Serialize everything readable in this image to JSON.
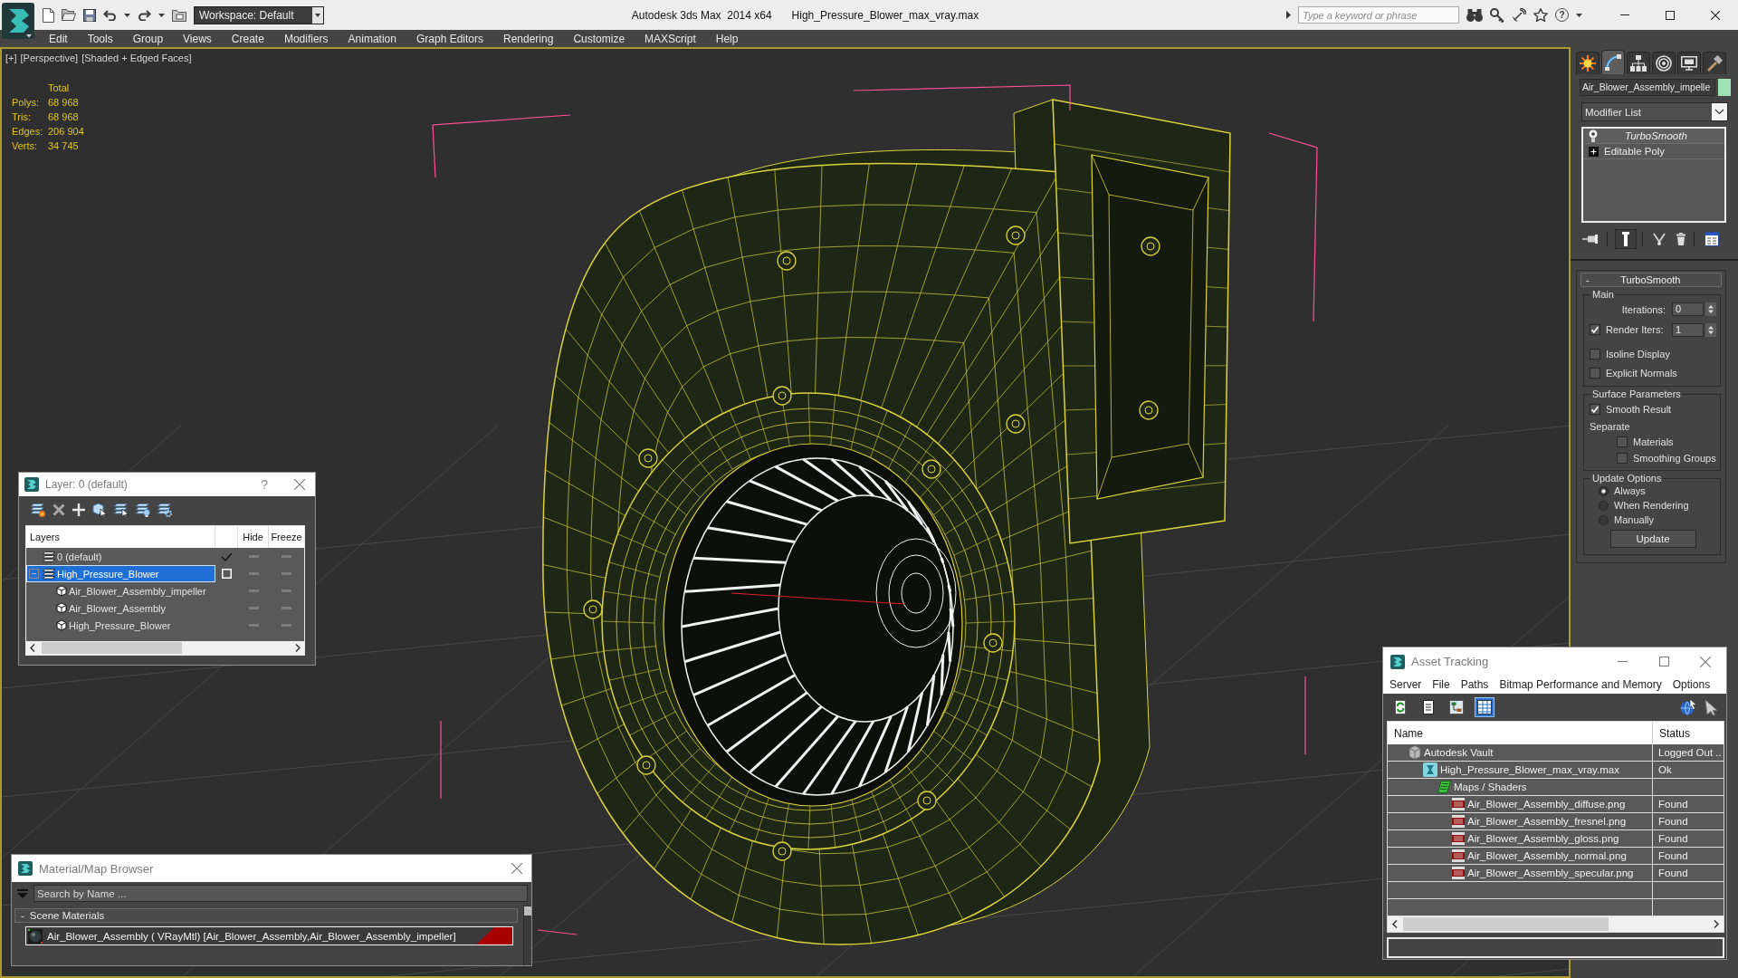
{
  "title_bar": {
    "workspace": "Workspace: Default",
    "app_title": "Autodesk 3ds Max  2014 x64",
    "file_name": "High_Pressure_Blower_max_vray.max",
    "search": {
      "placeholder": "Type a keyword or phrase"
    },
    "help": "?"
  },
  "menu_bar": [
    "Edit",
    "Tools",
    "Group",
    "Views",
    "Create",
    "Modifiers",
    "Animation",
    "Graph Editors",
    "Rendering",
    "Customize",
    "MAXScript",
    "Help"
  ],
  "viewport": {
    "labels": [
      "[+]",
      "[Perspective]",
      "[Shaded + Edged Faces]"
    ],
    "stats": {
      "heading": "Total",
      "rows": [
        {
          "label": "Polys:",
          "value": "68 968"
        },
        {
          "label": "Tris:",
          "value": "68 968"
        },
        {
          "label": "Edges:",
          "value": "206 904"
        },
        {
          "label": "Verts:",
          "value": "34 745"
        }
      ]
    }
  },
  "layer_manager": {
    "title": "Layer: 0 (default)",
    "help": "?",
    "columns": [
      "Layers",
      "Hide",
      "Freeze"
    ],
    "layers": [
      {
        "kind": "layer",
        "name": "0 (default)",
        "current": true,
        "selected": false,
        "hidden": false,
        "frozen": false
      },
      {
        "kind": "layer",
        "name": "High_Pressure_Blower",
        "current": false,
        "selected": true,
        "expanded": true,
        "hidden": false,
        "frozen": false,
        "children": [
          {
            "kind": "object",
            "name": "Air_Blower_Assembly_impeller",
            "selected": false,
            "hidden": false,
            "frozen": false
          },
          {
            "kind": "object",
            "name": "Air_Blower_Assembly",
            "selected": false,
            "hidden": false,
            "frozen": false
          },
          {
            "kind": "object",
            "name": "High_Pressure_Blower",
            "selected": false,
            "hidden": false,
            "frozen": false
          }
        ]
      }
    ]
  },
  "command_panel": {
    "tabs": [
      {
        "kind": "create",
        "selected": false
      },
      {
        "kind": "modify",
        "selected": true
      },
      {
        "kind": "hierarchy",
        "selected": false
      },
      {
        "kind": "motion",
        "selected": false
      },
      {
        "kind": "display",
        "selected": false
      },
      {
        "kind": "utilities",
        "selected": false
      }
    ],
    "object": {
      "name": "Air_Blower_Assembly_impelle",
      "color": "#9fe3b5"
    },
    "modifier_list": "Modifier List",
    "stack": [
      {
        "kind": "modifier",
        "name": "TurboSmooth"
      },
      {
        "kind": "base_object",
        "name": "Editable Poly"
      }
    ],
    "stack_tools": [
      {
        "kind": "pin",
        "on": false
      },
      {
        "kind": "end_result",
        "on": true
      },
      {
        "kind": "make_unique",
        "on": false
      },
      {
        "kind": "remove",
        "on": false
      },
      {
        "kind": "configure",
        "on": false
      }
    ],
    "rollout": {
      "toggle": "-",
      "title": "TurboSmooth",
      "groups": [
        {
          "title": "Main",
          "items": [
            {
              "kind": "spinner",
              "label": "Iterations:",
              "value": "0"
            },
            {
              "kind": "check_spinner",
              "label": "Render Iters:",
              "checked": true,
              "value": "1"
            },
            {
              "kind": "checkbox",
              "label": "Isoline Display",
              "checked": false
            },
            {
              "kind": "checkbox",
              "label": "Explicit Normals",
              "checked": false
            }
          ]
        },
        {
          "title": "Surface Parameters",
          "items": [
            {
              "kind": "checkbox",
              "label": "Smooth Result",
              "checked": true
            },
            {
              "kind": "label",
              "label": "Separate"
            },
            {
              "kind": "sub_checkbox",
              "label": "Materials",
              "checked": false
            },
            {
              "kind": "sub_checkbox",
              "label": "Smoothing Groups",
              "checked": false
            }
          ]
        },
        {
          "title": "Update Options",
          "items": [
            {
              "kind": "radio",
              "label": "Always",
              "selected": true
            },
            {
              "kind": "radio",
              "label": "When Rendering",
              "selected": false
            },
            {
              "kind": "radio",
              "label": "Manually",
              "selected": false
            },
            {
              "kind": "button",
              "label": "Update"
            }
          ]
        }
      ]
    }
  },
  "asset_tracking": {
    "title": "Asset Tracking",
    "menu": [
      "Server",
      "File",
      "Paths",
      "Bitmap Performance and Memory",
      "Options"
    ],
    "views": [
      {
        "kind": "refresh",
        "on": false
      },
      {
        "kind": "list",
        "on": false
      },
      {
        "kind": "tree",
        "on": false
      },
      {
        "kind": "table",
        "on": true
      }
    ],
    "columns": [
      "Name",
      "Status"
    ],
    "assets": [
      {
        "kind": "vault",
        "name": "Autodesk Vault",
        "status": "Logged Out ..",
        "children": [
          {
            "kind": "scene_file",
            "name": "High_Pressure_Blower_max_vray.max",
            "status": "Ok",
            "children": [
              {
                "kind": "folder",
                "name": "Maps / Shaders",
                "children": [
                  {
                    "kind": "image",
                    "name": "Air_Blower_Assembly_diffuse.png",
                    "status": "Found"
                  },
                  {
                    "kind": "image",
                    "name": "Air_Blower_Assembly_fresnel.png",
                    "status": "Found"
                  },
                  {
                    "kind": "image",
                    "name": "Air_Blower_Assembly_gloss.png",
                    "status": "Found"
                  },
                  {
                    "kind": "image",
                    "name": "Air_Blower_Assembly_normal.png",
                    "status": "Found"
                  },
                  {
                    "kind": "image",
                    "name": "Air_Blower_Assembly_specular.png",
                    "status": "Found"
                  }
                ]
              }
            ]
          }
        ]
      }
    ]
  },
  "material_browser": {
    "title": "Material/Map Browser",
    "search": {
      "placeholder": "Search by Name ..."
    },
    "groups": [
      {
        "toggle": "-",
        "title": "Scene Materials",
        "materials": [
          {
            "name": "Air_Blower_Assembly ( VRayMtl) [Air_Blower_Assembly,Air_Blower_Assembly_impeller]",
            "selected": true
          }
        ]
      }
    ]
  }
}
